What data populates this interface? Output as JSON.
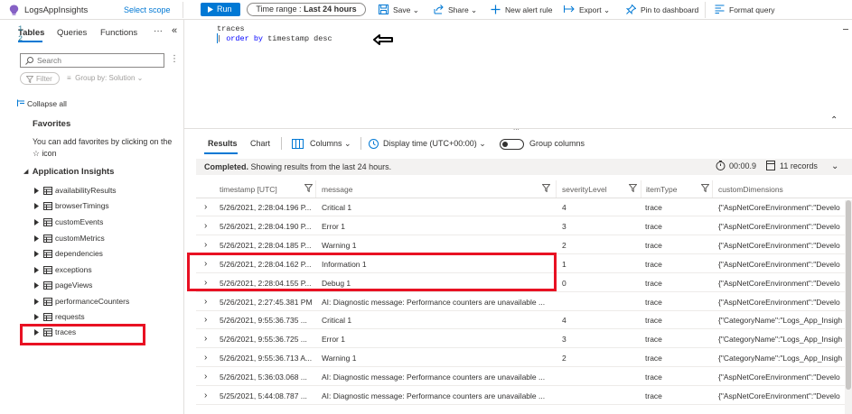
{
  "toolbar": {
    "app_title": "LogsAppInsights",
    "select_scope": "Select scope",
    "run_label": "Run",
    "time_range_prefix": "Time range :",
    "time_range_value": "Last 24 hours",
    "save_label": "Save",
    "share_label": "Share",
    "new_alert_rule_label": "New alert rule",
    "export_label": "Export",
    "pin_label": "Pin to dashboard",
    "format_query_label": "Format query"
  },
  "sidebar": {
    "tabs": [
      "Tables",
      "Queries",
      "Functions"
    ],
    "search_placeholder": "Search",
    "filter_label": "Filter",
    "group_by_label": "Group by: Solution",
    "collapse_all_label": "Collapse all",
    "favorites_heading": "Favorites",
    "favorites_desc": "You can add favorites by clicking on the ☆ icon",
    "section_heading": "Application Insights",
    "tables": [
      "availabilityResults",
      "browserTimings",
      "customEvents",
      "customMetrics",
      "dependencies",
      "exceptions",
      "pageViews",
      "performanceCounters",
      "requests",
      "traces"
    ]
  },
  "editor": {
    "line_numbers": [
      "1",
      "2"
    ],
    "line1": "traces",
    "line2_pipe": "| ",
    "line2_kw1": "order",
    "line2_kw2": "by",
    "line2_rest": "timestamp desc",
    "splitter_dots": "..."
  },
  "results": {
    "tabs": [
      "Results",
      "Chart"
    ],
    "columns_label": "Columns",
    "display_time_label": "Display time (UTC+00:00)",
    "group_columns_label": "Group columns",
    "status_bold": "Completed.",
    "status_rest": " Showing results from the last 24 hours.",
    "elapsed": "00:00.9",
    "record_count": "11 records",
    "columns": [
      "timestamp [UTC]",
      "message",
      "severityLevel",
      "itemType",
      "customDimensions"
    ],
    "rows": [
      {
        "timestamp": "5/26/2021, 2:28:04.196 P...",
        "message": "Critical 1",
        "severity": "4",
        "itemType": "trace",
        "dims": "{\"AspNetCoreEnvironment\":\"Develo"
      },
      {
        "timestamp": "5/26/2021, 2:28:04.190 P...",
        "message": "Error 1",
        "severity": "3",
        "itemType": "trace",
        "dims": "{\"AspNetCoreEnvironment\":\"Develo"
      },
      {
        "timestamp": "5/26/2021, 2:28:04.185 P...",
        "message": "Warning 1",
        "severity": "2",
        "itemType": "trace",
        "dims": "{\"AspNetCoreEnvironment\":\"Develo"
      },
      {
        "timestamp": "5/26/2021, 2:28:04.162 P...",
        "message": "Information 1",
        "severity": "1",
        "itemType": "trace",
        "dims": "{\"AspNetCoreEnvironment\":\"Develo"
      },
      {
        "timestamp": "5/26/2021, 2:28:04.155 P...",
        "message": "Debug 1",
        "severity": "0",
        "itemType": "trace",
        "dims": "{\"AspNetCoreEnvironment\":\"Develo"
      },
      {
        "timestamp": "5/26/2021, 2:27:45.381 PM",
        "message": "AI: Diagnostic message: Performance counters are unavailable ...",
        "severity": "",
        "itemType": "trace",
        "dims": "{\"AspNetCoreEnvironment\":\"Develo"
      },
      {
        "timestamp": "5/26/2021, 9:55:36.735 ...",
        "message": "Critical 1",
        "severity": "4",
        "itemType": "trace",
        "dims": "{\"CategoryName\":\"Logs_App_Insigh"
      },
      {
        "timestamp": "5/26/2021, 9:55:36.725 ...",
        "message": "Error 1",
        "severity": "3",
        "itemType": "trace",
        "dims": "{\"CategoryName\":\"Logs_App_Insigh"
      },
      {
        "timestamp": "5/26/2021, 9:55:36.713 A...",
        "message": "Warning 1",
        "severity": "2",
        "itemType": "trace",
        "dims": "{\"CategoryName\":\"Logs_App_Insigh"
      },
      {
        "timestamp": "5/26/2021, 5:36:03.068 ...",
        "message": "AI: Diagnostic message: Performance counters are unavailable ...",
        "severity": "",
        "itemType": "trace",
        "dims": "{\"AspNetCoreEnvironment\":\"Develo"
      },
      {
        "timestamp": "5/25/2021, 5:44:08.787 ...",
        "message": "AI: Diagnostic message: Performance counters are unavailable ...",
        "severity": "",
        "itemType": "trace",
        "dims": "{\"AspNetCoreEnvironment\":\"Develo"
      }
    ]
  },
  "colors": {
    "accent": "#0078d4",
    "highlight": "#e81123"
  }
}
